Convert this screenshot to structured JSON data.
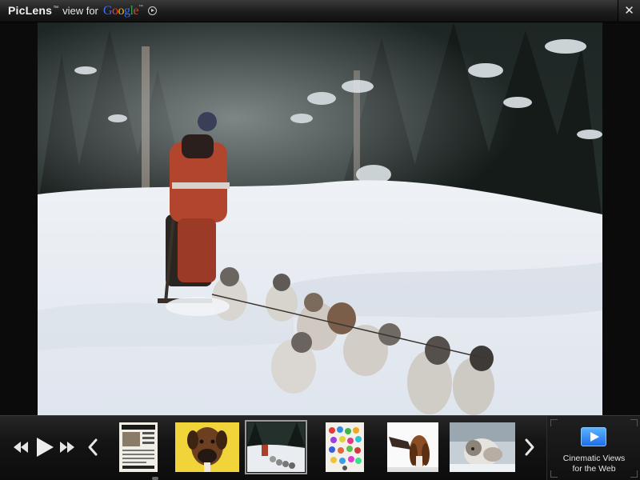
{
  "titlebar": {
    "brand": "PicLens",
    "brand_tm": "™",
    "view_for": "view for",
    "google_letters": [
      "G",
      "o",
      "o",
      "g",
      "l",
      "e"
    ],
    "google_tm": "™",
    "close_glyph": "✕"
  },
  "viewer": {
    "current_index": 2,
    "photo_subject": "dog sled team in snow"
  },
  "thumbnails": [
    {
      "subject": "lost dog flyer",
      "selected": false
    },
    {
      "subject": "boxer dog on yellow",
      "selected": false
    },
    {
      "subject": "dog sled team",
      "selected": true
    },
    {
      "subject": "colorful collage",
      "selected": false
    },
    {
      "subject": "basset hound",
      "selected": false
    },
    {
      "subject": "husky puppy",
      "selected": false
    }
  ],
  "controls": {
    "prev_set_icon": "rewind-icon",
    "play_icon": "play-icon",
    "next_set_icon": "fast-forward-icon",
    "scroll_left_icon": "chevron-left-icon",
    "scroll_right_icon": "chevron-right-icon"
  },
  "cinematic": {
    "line1": "Cinematic Views",
    "line2": "for the Web",
    "icon": "play-screen-icon",
    "icon_color": "#2a86f5"
  },
  "colors": {
    "titlebar": "#222222",
    "background": "#0b0b0b",
    "control_glyph": "#e6e6e6"
  }
}
